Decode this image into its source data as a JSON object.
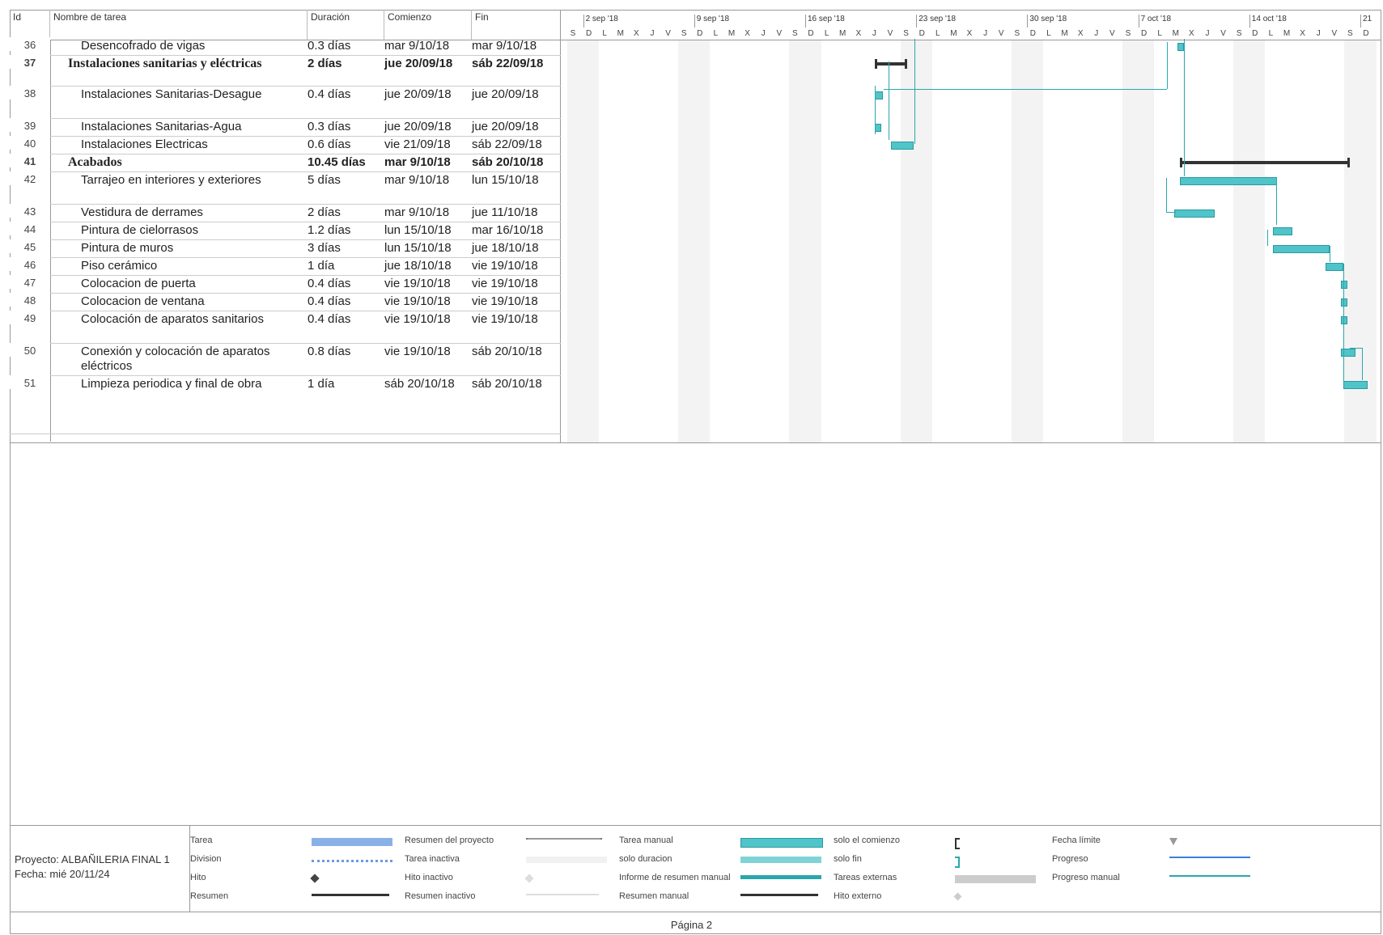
{
  "table": {
    "headers": {
      "id": "Id",
      "name": "Nombre de tarea",
      "duration": "Duración",
      "start": "Comienzo",
      "finish": "Fin"
    },
    "rows": [
      {
        "id": "36",
        "name": "Desencofrado de vigas",
        "duration": "0.3 días",
        "start": "mar 9/10/18",
        "finish": "mar 9/10/18"
      },
      {
        "id": "37",
        "name": "Instalaciones sanitarias y eléctricas",
        "duration": "2 días",
        "start": "jue 20/09/18",
        "finish": "sáb 22/09/18"
      },
      {
        "id": "38",
        "name": "Instalaciones Sanitarias-Desague",
        "duration": "0.4 días",
        "start": "jue 20/09/18",
        "finish": "jue 20/09/18"
      },
      {
        "id": "39",
        "name": "Instalaciones Sanitarias-Agua",
        "duration": "0.3 días",
        "start": "jue 20/09/18",
        "finish": "jue 20/09/18"
      },
      {
        "id": "40",
        "name": "Instalaciones Electricas",
        "duration": "0.6 días",
        "start": "vie 21/09/18",
        "finish": "sáb 22/09/18"
      },
      {
        "id": "41",
        "name": "Acabados",
        "duration": "10.45 días",
        "start": "mar 9/10/18",
        "finish": "sáb 20/10/18"
      },
      {
        "id": "42",
        "name": "Tarrajeo en interiores y exteriores",
        "duration": "5 días",
        "start": "mar 9/10/18",
        "finish": "lun 15/10/18"
      },
      {
        "id": "43",
        "name": "Vestidura de derrames",
        "duration": "2 días",
        "start": "mar 9/10/18",
        "finish": "jue 11/10/18"
      },
      {
        "id": "44",
        "name": "Pintura de cielorrasos",
        "duration": "1.2 días",
        "start": "lun 15/10/18",
        "finish": "mar 16/10/18"
      },
      {
        "id": "45",
        "name": "Pintura de muros",
        "duration": "3 días",
        "start": "lun 15/10/18",
        "finish": "jue 18/10/18"
      },
      {
        "id": "46",
        "name": "Piso cerámico",
        "duration": "1 día",
        "start": "jue 18/10/18",
        "finish": "vie 19/10/18"
      },
      {
        "id": "47",
        "name": "Colocacion de puerta",
        "duration": "0.4 días",
        "start": "vie 19/10/18",
        "finish": "vie 19/10/18"
      },
      {
        "id": "48",
        "name": "Colocacion de ventana",
        "duration": "0.4 días",
        "start": "vie 19/10/18",
        "finish": "vie 19/10/18"
      },
      {
        "id": "49",
        "name": "Colocación de aparatos sanitarios",
        "duration": "0.4 días",
        "start": "vie 19/10/18",
        "finish": "vie 19/10/18"
      },
      {
        "id": "50",
        "name": "Conexión y colocación de aparatos",
        "name2": "eléctricos",
        "duration": "0.8 días",
        "start": "vie 19/10/18",
        "finish": "sáb 20/10/18"
      },
      {
        "id": "51",
        "name": "Limpieza periodica y final de obra",
        "duration": "1 día",
        "start": "sáb 20/10/18",
        "finish": "sáb 20/10/18"
      }
    ]
  },
  "timescale": {
    "weeks": [
      "2 sep '18",
      "9 sep '18",
      "16 sep '18",
      "23 sep '18",
      "30 sep '18",
      "7 oct '18",
      "14 oct '18",
      "21"
    ],
    "days": [
      "S",
      "D",
      "L",
      "M",
      "X",
      "J",
      "V",
      "S",
      "D",
      "L",
      "M",
      "X",
      "J",
      "V",
      "S",
      "D",
      "L",
      "M",
      "X",
      "J",
      "V",
      "S",
      "D",
      "L",
      "M",
      "X",
      "J",
      "V",
      "S",
      "D",
      "L",
      "M",
      "X",
      "J",
      "V",
      "S",
      "D",
      "L",
      "M",
      "X",
      "J",
      "V",
      "S",
      "D",
      "L",
      "M",
      "X",
      "J",
      "V",
      "S",
      "D"
    ]
  },
  "legend": {
    "project": "Proyecto: ALBAÑILERIA FINAL 1",
    "date": "Fecha: mié 20/11/24",
    "items": [
      {
        "label": "Tarea",
        "swatch": "task-bar"
      },
      {
        "label": "Division",
        "swatch": "split"
      },
      {
        "label": "Hito",
        "swatch": "milestone"
      },
      {
        "label": "Resumen",
        "swatch": "summary"
      },
      {
        "label": "Resumen del proyecto",
        "swatch": "project-summary"
      },
      {
        "label": "Tarea inactiva",
        "swatch": "inactive-task"
      },
      {
        "label": "Hito inactivo",
        "swatch": "inactive-milestone"
      },
      {
        "label": "Resumen inactivo",
        "swatch": "inactive-summary"
      },
      {
        "label": "Tarea manual",
        "swatch": "manual-task"
      },
      {
        "label": "solo duracion",
        "swatch": "duration-only"
      },
      {
        "label": "Informe de resumen manual",
        "swatch": "manual-summary-rollup"
      },
      {
        "label": "Resumen manual",
        "swatch": "manual-summary"
      },
      {
        "label": "solo el comienzo",
        "swatch": "start-only"
      },
      {
        "label": "solo fin",
        "swatch": "finish-only"
      },
      {
        "label": "Tareas externas",
        "swatch": "external-tasks"
      },
      {
        "label": "Hito externo",
        "swatch": "external-milestone"
      },
      {
        "label": "Fecha límite",
        "swatch": "deadline"
      },
      {
        "label": "Progreso",
        "swatch": "progress"
      },
      {
        "label": "Progreso manual",
        "swatch": "manual-progress"
      }
    ],
    "colors": {
      "task": "#6a9be0",
      "manual": "#4fc4c9",
      "summary": "#333333",
      "progress": "#3b7ddd",
      "manual_progress": "#2aa7ad"
    }
  },
  "footer": {
    "page": "Página 2"
  }
}
